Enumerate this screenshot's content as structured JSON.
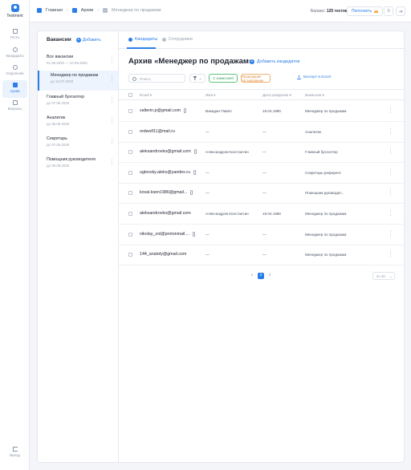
{
  "brand": {
    "name": "Testment"
  },
  "nav": {
    "items": [
      {
        "label": "Тесты"
      },
      {
        "label": "Кандидаты"
      },
      {
        "label": "Отделения"
      },
      {
        "label": "Архив"
      },
      {
        "label": "Вопросы"
      }
    ],
    "active": "Архив",
    "logout_label": "Выход"
  },
  "topbar": {
    "breadcrumbs": [
      "Главная",
      "Архив",
      "Менеджер по продажам"
    ],
    "balance_label": "Баланс:",
    "balance_value": "125 тестов",
    "topup_label": "Пополнить"
  },
  "vacancies": {
    "title": "Вакансии",
    "add_label": "Добавить",
    "items": [
      {
        "title": "Все вакансии",
        "date": "01.08.2020 — 10.09.2020"
      },
      {
        "title": "Менеджер по продажам",
        "date": "до 12.07.2020"
      },
      {
        "title": "Главный бухгалтер",
        "date": "до 07.05.2020"
      },
      {
        "title": "Аналитик",
        "date": "до 05.08.2020"
      },
      {
        "title": "Секретарь",
        "date": "до 07.05.2020"
      },
      {
        "title": "Помощник руководителя",
        "date": "до 05.09.2020"
      }
    ],
    "active_index": 1
  },
  "main": {
    "tabs": [
      {
        "label": "Кандидаты"
      },
      {
        "label": "Сотрудники"
      }
    ],
    "active_tab": "Кандидаты",
    "title": "Архив «Менеджер по продажам»",
    "add_candidate_label": "Добавить кандидатов",
    "search_placeholder": "Поиск...",
    "filter_chip_green": "С комиссией",
    "filter_chip_orange": "Прошедшие тестирование",
    "export_label": "Экспорт в Excel",
    "columns": {
      "email": "Email",
      "name": "Имя",
      "birth": "Дата рождения",
      "vacancy": "Вакансия"
    },
    "rows": [
      {
        "email": "valterin.p@gmail.com",
        "phone": true,
        "name": "Вакадин Павел",
        "birth": "19.04.1980",
        "vacancy": "Менеджер по продажам"
      },
      {
        "email": "redwolf11@mail.ru",
        "phone": false,
        "name": "—",
        "birth": "—",
        "vacancy": "Аналитик"
      },
      {
        "email": "aleksandrovko@gmail.com",
        "phone": true,
        "name": "Александров Константин",
        "birth": "—",
        "vacancy": "Главный бухгалтер"
      },
      {
        "email": "ugtovsky.aleks@yandex.ru",
        "phone": true,
        "name": "—",
        "birth": "—",
        "vacancy": "Секретарь-референт"
      },
      {
        "email": "koval.ksen1986@gmail...",
        "phone": true,
        "name": "—",
        "birth": "—",
        "vacancy": "Помощник руководит..."
      },
      {
        "email": "aleksandrovko@gmail.com",
        "phone": false,
        "name": "Александров Константин",
        "birth": "19.04.1980",
        "vacancy": "Менеджер по продажам"
      },
      {
        "email": "nikolay_zol@protonmail....",
        "phone": true,
        "name": "—",
        "birth": "—",
        "vacancy": "Менеджер по продажам"
      },
      {
        "email": "144_anatoly@gmail.com",
        "phone": false,
        "name": "—",
        "birth": "—",
        "vacancy": "Менеджер по продажам"
      }
    ],
    "pagination": [
      "1",
      "2",
      "3"
    ],
    "active_page": "2",
    "per_page": "по 10"
  },
  "colors": {
    "accent": "#2b7de9",
    "green": "#3ca35c",
    "orange": "#e0893b"
  }
}
